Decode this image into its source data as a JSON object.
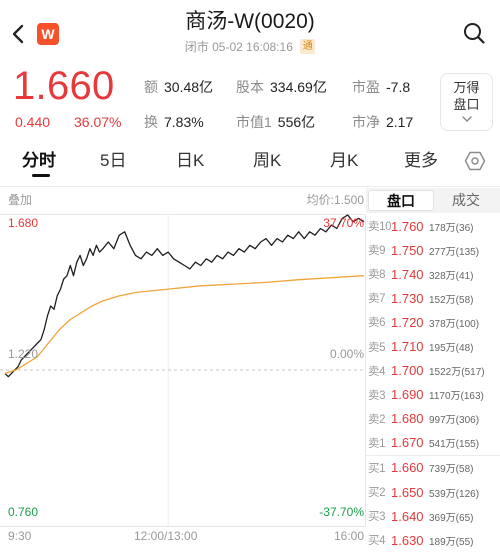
{
  "header": {
    "back_icon": "chevron-left-icon",
    "logo_text": "W",
    "title": "商汤-W(0020)",
    "status": "闭市",
    "datetime": "05-02 16:08:16",
    "badge": "通",
    "search_icon": "search-icon"
  },
  "quote": {
    "price": "1.660",
    "change": "0.440",
    "change_pct": "36.07%",
    "stats": [
      {
        "label": "额",
        "value": "30.48亿"
      },
      {
        "label": "股本",
        "value": "334.69亿"
      },
      {
        "label": "市盈",
        "value": "-7.8"
      },
      {
        "label": "换",
        "value": "7.83%"
      },
      {
        "label": "市值1",
        "value": "556亿"
      },
      {
        "label": "市净",
        "value": "2.17"
      }
    ],
    "depth_button": {
      "line1": "万得",
      "line2": "盘口",
      "icon": "chevron-down-icon"
    }
  },
  "tabs": {
    "items": [
      {
        "label": "分时",
        "active": true
      },
      {
        "label": "5日"
      },
      {
        "label": "日K"
      },
      {
        "label": "周K"
      },
      {
        "label": "月K"
      },
      {
        "label": "更多"
      }
    ],
    "settings_icon": "settings-icon"
  },
  "chart": {
    "overlay_label": "叠加",
    "avg_price_label": "均价:1.500"
  },
  "chart_data": {
    "type": "line",
    "ylim": [
      0.76,
      1.68
    ],
    "baseline": 1.22,
    "y_tick_labels": [
      "1.680",
      "1.220",
      "0.760"
    ],
    "pct_tick_labels": [
      "37.70%",
      "0.00%",
      "-37.70%"
    ],
    "x_tick_labels": [
      "9:30",
      "12:00/13:00",
      "16:00"
    ],
    "series": [
      {
        "points": [
          [
            "09:30",
            1.21
          ],
          [
            "09:33",
            1.2
          ],
          [
            "09:36",
            1.21
          ],
          [
            "09:39",
            1.22
          ],
          [
            "09:42",
            1.23
          ],
          [
            "09:45",
            1.25
          ],
          [
            "09:48",
            1.26
          ],
          [
            "09:51",
            1.27
          ],
          [
            "09:54",
            1.28
          ],
          [
            "09:57",
            1.29
          ],
          [
            "10:00",
            1.3
          ],
          [
            "10:03",
            1.31
          ],
          [
            "10:06",
            1.34
          ],
          [
            "10:09",
            1.38
          ],
          [
            "10:12",
            1.41
          ],
          [
            "10:15",
            1.4
          ],
          [
            "10:18",
            1.44
          ],
          [
            "10:21",
            1.46
          ],
          [
            "10:24",
            1.49
          ],
          [
            "10:27",
            1.5
          ],
          [
            "10:30",
            1.53
          ],
          [
            "10:33",
            1.5
          ],
          [
            "10:36",
            1.54
          ],
          [
            "10:39",
            1.56
          ],
          [
            "10:42",
            1.53
          ],
          [
            "10:45",
            1.55
          ],
          [
            "10:48",
            1.58
          ],
          [
            "10:51",
            1.56
          ],
          [
            "10:54",
            1.59
          ],
          [
            "10:57",
            1.57
          ],
          [
            "11:00",
            1.58
          ],
          [
            "11:05",
            1.6
          ],
          [
            "11:10",
            1.58
          ],
          [
            "11:15",
            1.62
          ],
          [
            "11:20",
            1.63
          ],
          [
            "11:25",
            1.59
          ],
          [
            "11:30",
            1.56
          ],
          [
            "11:35",
            1.55
          ],
          [
            "11:40",
            1.57
          ],
          [
            "11:45",
            1.56
          ],
          [
            "11:50",
            1.58
          ],
          [
            "11:55",
            1.56
          ],
          [
            "12:00",
            1.57
          ],
          [
            "13:05",
            1.55
          ],
          [
            "13:10",
            1.54
          ],
          [
            "13:15",
            1.53
          ],
          [
            "13:20",
            1.52
          ],
          [
            "13:25",
            1.54
          ],
          [
            "13:30",
            1.53
          ],
          [
            "13:35",
            1.55
          ],
          [
            "13:40",
            1.54
          ],
          [
            "13:45",
            1.56
          ],
          [
            "13:50",
            1.55
          ],
          [
            "13:55",
            1.57
          ],
          [
            "14:00",
            1.56
          ],
          [
            "14:05",
            1.58
          ],
          [
            "14:10",
            1.57
          ],
          [
            "14:15",
            1.59
          ],
          [
            "14:20",
            1.58
          ],
          [
            "14:25",
            1.6
          ],
          [
            "14:30",
            1.61
          ],
          [
            "14:35",
            1.59
          ],
          [
            "14:40",
            1.61
          ],
          [
            "14:45",
            1.6
          ],
          [
            "14:50",
            1.62
          ],
          [
            "14:55",
            1.61
          ],
          [
            "15:00",
            1.63
          ],
          [
            "15:05",
            1.61
          ],
          [
            "15:10",
            1.63
          ],
          [
            "15:15",
            1.62
          ],
          [
            "15:20",
            1.64
          ],
          [
            "15:25",
            1.63
          ],
          [
            "15:30",
            1.65
          ],
          [
            "15:35",
            1.64
          ],
          [
            "15:40",
            1.67
          ],
          [
            "15:45",
            1.68
          ],
          [
            "15:50",
            1.66
          ],
          [
            "15:55",
            1.67
          ],
          [
            "16:00",
            1.66
          ]
        ]
      },
      {
        "points": [
          [
            "09:30",
            1.21
          ],
          [
            "09:40",
            1.22
          ],
          [
            "09:50",
            1.24
          ],
          [
            "10:00",
            1.26
          ],
          [
            "10:10",
            1.3
          ],
          [
            "10:20",
            1.34
          ],
          [
            "10:30",
            1.37
          ],
          [
            "10:40",
            1.39
          ],
          [
            "10:50",
            1.41
          ],
          [
            "11:00",
            1.425
          ],
          [
            "11:15",
            1.44
          ],
          [
            "11:30",
            1.45
          ],
          [
            "12:00",
            1.46
          ],
          [
            "13:30",
            1.47
          ],
          [
            "14:00",
            1.475
          ],
          [
            "14:30",
            1.48
          ],
          [
            "15:00",
            1.488
          ],
          [
            "15:30",
            1.494
          ],
          [
            "16:00",
            1.5
          ]
        ]
      }
    ]
  },
  "order_book": {
    "tabs": [
      {
        "label": "盘口",
        "active": true
      },
      {
        "label": "成交"
      }
    ],
    "asks": [
      {
        "label": "卖10",
        "price": "1.760",
        "volume": "178万(36)"
      },
      {
        "label": "卖9",
        "price": "1.750",
        "volume": "277万(135)"
      },
      {
        "label": "卖8",
        "price": "1.740",
        "volume": "328万(41)"
      },
      {
        "label": "卖7",
        "price": "1.730",
        "volume": "152万(58)"
      },
      {
        "label": "卖6",
        "price": "1.720",
        "volume": "378万(100)"
      },
      {
        "label": "卖5",
        "price": "1.710",
        "volume": "195万(48)"
      },
      {
        "label": "卖4",
        "price": "1.700",
        "volume": "1522万(517)"
      },
      {
        "label": "卖3",
        "price": "1.690",
        "volume": "1170万(163)"
      },
      {
        "label": "卖2",
        "price": "1.680",
        "volume": "997万(306)"
      },
      {
        "label": "卖1",
        "price": "1.670",
        "volume": "541万(155)"
      }
    ],
    "bids": [
      {
        "label": "买1",
        "price": "1.660",
        "volume": "739万(58)"
      },
      {
        "label": "买2",
        "price": "1.650",
        "volume": "539万(126)"
      },
      {
        "label": "买3",
        "price": "1.640",
        "volume": "369万(65)"
      },
      {
        "label": "买4",
        "price": "1.630",
        "volume": "189万(55)"
      }
    ]
  },
  "colors": {
    "up": "#e5393b",
    "down": "#1a9f4a",
    "brand": "#f5512b",
    "muted": "#999999",
    "price_line": "#1f1f1f",
    "avg_line": "#f0a43a"
  }
}
